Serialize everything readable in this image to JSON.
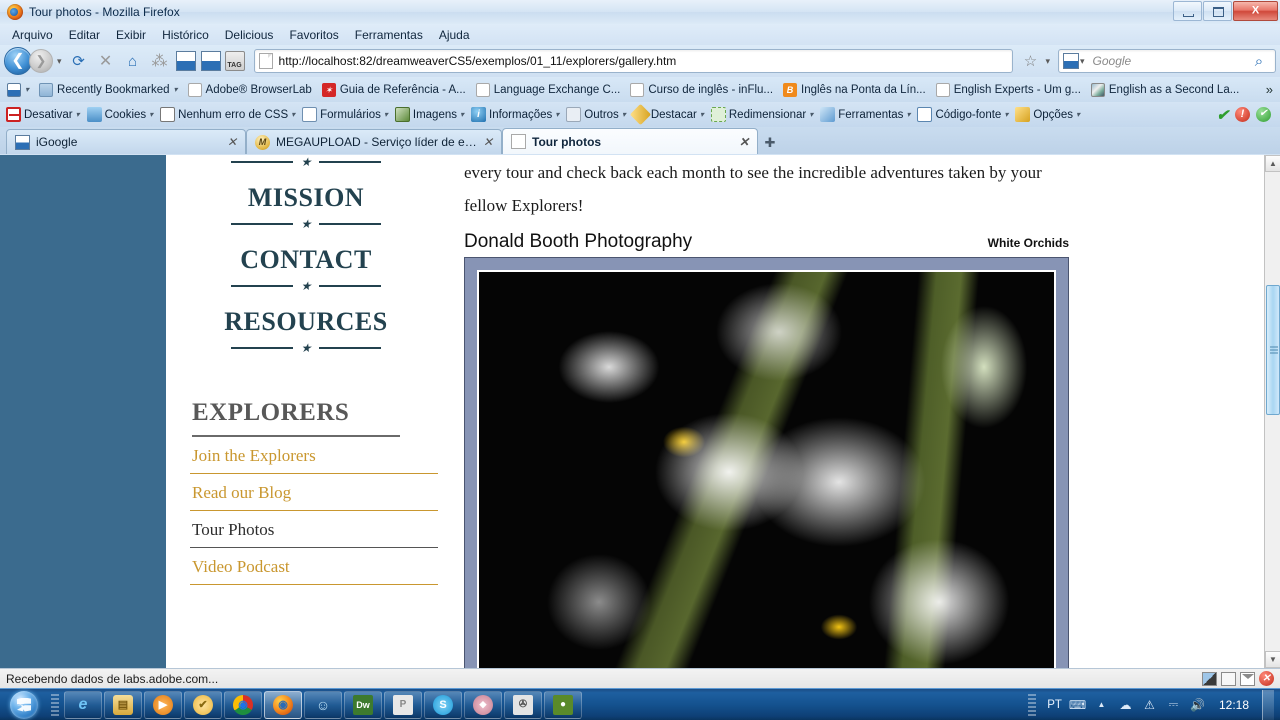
{
  "window": {
    "title": "Tour photos - Mozilla Firefox",
    "minimize_label": "Minimize",
    "maximize_label": "Maximize",
    "close_label": "X"
  },
  "menubar": [
    {
      "label": "Arquivo"
    },
    {
      "label": "Editar"
    },
    {
      "label": "Exibir"
    },
    {
      "label": "Histórico"
    },
    {
      "label": "Delicious"
    },
    {
      "label": "Favoritos"
    },
    {
      "label": "Ferramentas"
    },
    {
      "label": "Ajuda"
    }
  ],
  "navbar": {
    "back_glyph": "❮",
    "forward_glyph": "❯",
    "reload_glyph": "⟳",
    "stop_glyph": "✕",
    "home_glyph": "⌂",
    "delicious_glyph": "⁂",
    "tag_label": "TAG",
    "url": "http://localhost:82/dreamweaverCS5/exemplos/01_11/explorers/gallery.htm",
    "bookmark_star_glyph": "☆",
    "caret_glyph": "▾",
    "search_placeholder": "Google",
    "search_glyph": "⌕"
  },
  "bookmarks": {
    "items": [
      {
        "label": "",
        "icon": "folder-icon",
        "kind": "multi",
        "caret": true
      },
      {
        "label": "Recently Bookmarked",
        "icon": "folder-icon",
        "kind": "folder",
        "caret": true
      },
      {
        "label": "Adobe® BrowserLab",
        "icon": "page-icon",
        "kind": "doc",
        "caret": false
      },
      {
        "label": "Guia de Referência - A...",
        "icon": "star-icon",
        "kind": "red",
        "caret": false
      },
      {
        "label": "Language Exchange C...",
        "icon": "page-icon",
        "kind": "doc",
        "caret": false
      },
      {
        "label": "Curso de inglês - inFlu...",
        "icon": "page-icon",
        "kind": "doc",
        "caret": false
      },
      {
        "label": "Inglês na Ponta da Lín...",
        "icon": "blogger-icon",
        "kind": "orange",
        "caret": false
      },
      {
        "label": "English Experts - Um g...",
        "icon": "page-icon",
        "kind": "doc",
        "caret": false
      },
      {
        "label": "English as a Second La...",
        "icon": "site-icon",
        "kind": "img",
        "caret": false
      }
    ],
    "overflow_glyph": "»"
  },
  "devtoolbar": {
    "items": [
      {
        "label": "Desativar",
        "icon": "disable-icon",
        "kind": "red"
      },
      {
        "label": "Cookies",
        "icon": "cookies-icon",
        "kind": "person"
      },
      {
        "label": "Nenhum erro de CSS",
        "icon": "css-icon",
        "kind": "css"
      },
      {
        "label": "Formulários",
        "icon": "forms-icon",
        "kind": "form"
      },
      {
        "label": "Imagens",
        "icon": "images-icon",
        "kind": "img"
      },
      {
        "label": "Informações",
        "icon": "information-icon",
        "kind": "info"
      },
      {
        "label": "Outros",
        "icon": "misc-icon",
        "kind": "cloud"
      },
      {
        "label": "Destacar",
        "icon": "outline-icon",
        "kind": "pen"
      },
      {
        "label": "Redimensionar",
        "icon": "resize-icon",
        "kind": "resize"
      },
      {
        "label": "Ferramentas",
        "icon": "tools-icon",
        "kind": "tool"
      },
      {
        "label": "Código-fonte",
        "icon": "view-source-icon",
        "kind": "src"
      },
      {
        "label": "Opções",
        "icon": "options-icon",
        "kind": "opt"
      }
    ],
    "caret_glyph": "▾",
    "status": {
      "check_glyph": "✔",
      "error_glyph": "!",
      "ok_glyph": "✔"
    }
  },
  "tabs": {
    "items": [
      {
        "label": "iGoogle",
        "icon": "igoogle-icon",
        "active": false,
        "close_glyph": "✕"
      },
      {
        "label": "MEGAUPLOAD - Serviço líder de en...",
        "icon": "megaupload-icon",
        "active": false,
        "close_glyph": "✕"
      },
      {
        "label": "Tour photos",
        "icon": "page-icon",
        "active": true,
        "close_glyph": "✕"
      }
    ],
    "new_tab_glyph": "✚"
  },
  "page": {
    "sidebar": {
      "nav": [
        {
          "label": "MISSION"
        },
        {
          "label": "CONTACT"
        },
        {
          "label": "RESOURCES"
        }
      ],
      "star_glyph": "★",
      "explorers_title": "EXPLORERS",
      "explorers_links": [
        {
          "label": "Join the Explorers",
          "current": false
        },
        {
          "label": "Read our Blog",
          "current": false
        },
        {
          "label": "Tour Photos",
          "current": true
        },
        {
          "label": "Video Podcast",
          "current": false
        }
      ]
    },
    "main": {
      "paragraph_line1": "every tour and check back each month to see the incredible adventures taken by your",
      "paragraph_line2": "fellow Explorers!",
      "photographer": "Donald Booth Photography",
      "photo_caption": "White Orchids",
      "photo_alt": "white-orchids-photo"
    },
    "colors": {
      "page_background": "#3b6b8e",
      "content_background": "#ffffff",
      "heading": "#23424f",
      "link_gold": "#c9972f",
      "explorers_heading": "#585858",
      "photo_frame": "#8794b5"
    },
    "scrollbar": {
      "up_glyph": "▲",
      "down_glyph": "▼"
    }
  },
  "statusbar": {
    "text": "Recebendo dados de labs.adobe.com...",
    "icons": [
      {
        "name": "image-status-icon"
      },
      {
        "name": "addon-status-icon"
      },
      {
        "name": "mail-status-icon"
      },
      {
        "name": "error-status-icon",
        "glyph": "✕"
      }
    ]
  },
  "taskbar": {
    "start_label": "Start",
    "buttons": [
      {
        "name": "internet-explorer-icon",
        "glyph": "e",
        "color": "#2a7fd4",
        "active": false
      },
      {
        "name": "windows-explorer-icon",
        "glyph": "▤",
        "color": "#e0b24a",
        "active": false
      },
      {
        "name": "media-player-icon",
        "glyph": "▶",
        "color": "#f08a1c",
        "active": false
      },
      {
        "name": "avg-icon",
        "glyph": "✔",
        "color": "#f2b33c",
        "active": false
      },
      {
        "name": "chrome-icon",
        "glyph": "◉",
        "color": "#4caf50",
        "active": false
      },
      {
        "name": "firefox-icon",
        "glyph": "◉",
        "color": "#e8761a",
        "active": true
      },
      {
        "name": "msn-icon",
        "glyph": "☺",
        "color": "#7fb5e0",
        "active": false
      },
      {
        "name": "dreamweaver-icon",
        "glyph": "Dw",
        "color": "#3d7a2e",
        "active": false
      },
      {
        "name": "powerpoint-icon",
        "glyph": "P",
        "color": "#c9c9c9",
        "active": false
      },
      {
        "name": "skype-icon",
        "glyph": "S",
        "color": "#2a9fd8",
        "active": false
      },
      {
        "name": "photo-icon",
        "glyph": "◆",
        "color": "#d89aa8",
        "active": false
      },
      {
        "name": "movie-maker-icon",
        "glyph": "✇",
        "color": "#8a8a8a",
        "active": false
      },
      {
        "name": "app-icon",
        "glyph": "●",
        "color": "#5a8a2a",
        "active": false
      }
    ],
    "tray": {
      "language": "PT",
      "keyboard_icon": "keyboard-icon",
      "expand_glyph": "▲",
      "icons": [
        {
          "name": "modem-icon",
          "glyph": "☁"
        },
        {
          "name": "network-warning-icon",
          "glyph": "⚠"
        },
        {
          "name": "network-icon",
          "glyph": "⎓"
        },
        {
          "name": "volume-icon",
          "glyph": "ὐA"
        }
      ],
      "clock": "12:18"
    }
  }
}
